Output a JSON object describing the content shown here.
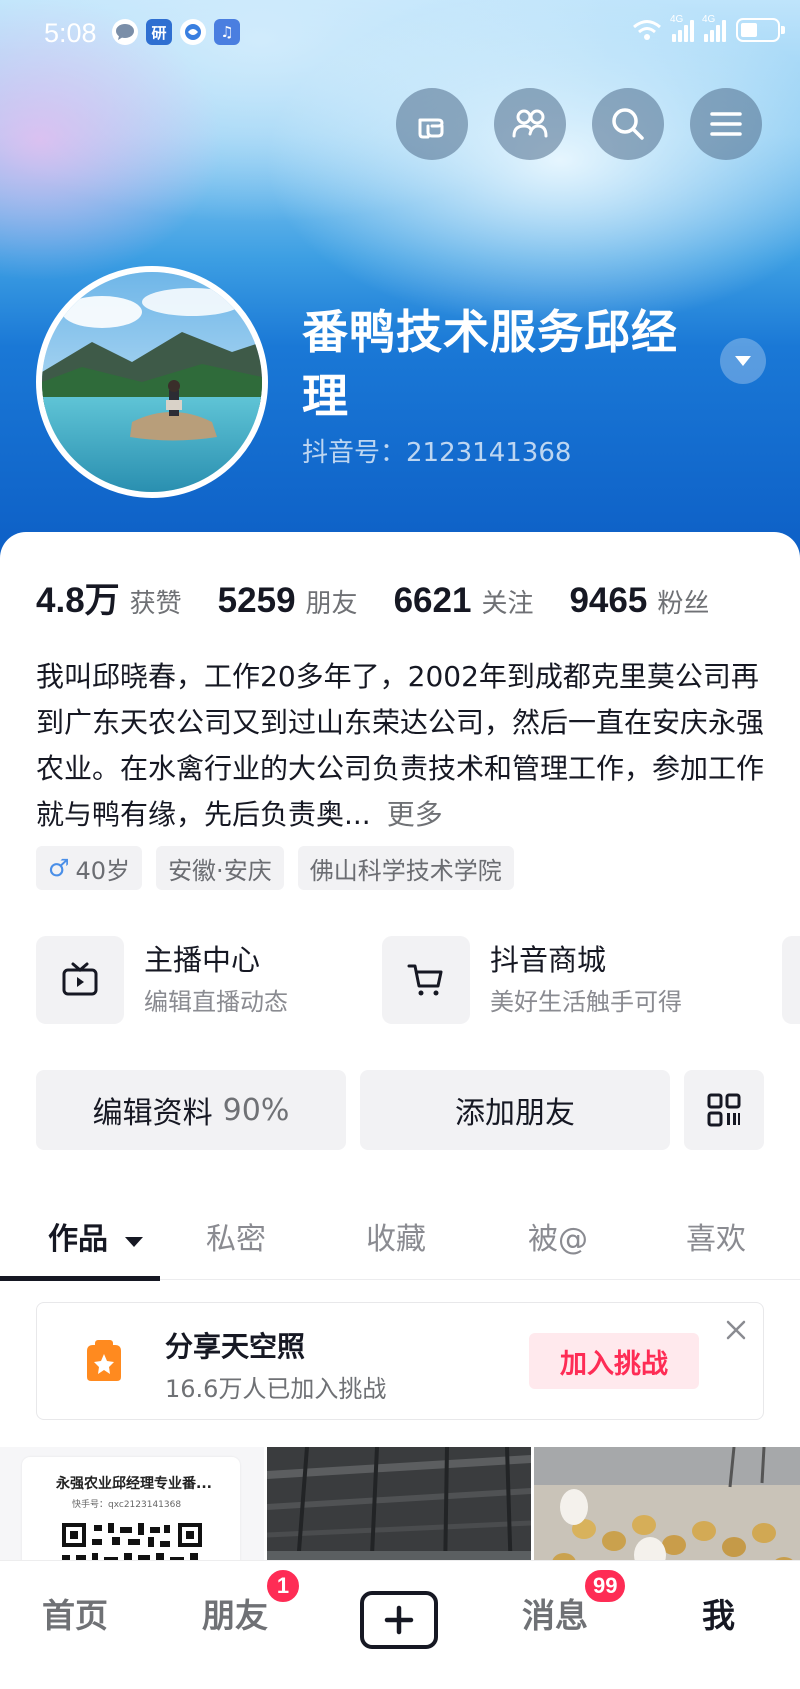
{
  "status_bar": {
    "time": "5:08",
    "app_icons": [
      "message-bubble-icon",
      "dictionary-app-icon",
      "browser-app-icon",
      "music-app-icon"
    ],
    "network_labels": [
      "4G",
      "4G"
    ],
    "battery_level": 0.35
  },
  "header_actions": [
    "hand-pointer-icon",
    "friends-icon",
    "search-icon",
    "menu-icon"
  ],
  "profile": {
    "nickname": "番鸭技术服务邱经理",
    "douyin_id": "抖音号：2123141368"
  },
  "stats": [
    {
      "num": "4.8万",
      "label": "获赞"
    },
    {
      "num": "5259",
      "label": "朋友"
    },
    {
      "num": "6621",
      "label": "关注"
    },
    {
      "num": "9465",
      "label": "粉丝"
    }
  ],
  "bio": {
    "text": "我叫邱晓春，工作20多年了，2002年到成都克里莫公司再到广东天农公司又到过山东荣达公司，然后一直在安庆永强农业。在水禽行业的大公司负责技术和管理工作，参加工作就与鸭有缘，先后负责奥...",
    "more": "更多"
  },
  "tags": {
    "age": "40岁",
    "location": "安徽·安庆",
    "school": "佛山科学技术学院"
  },
  "services": [
    {
      "title": "主播中心",
      "subtitle": "编辑直播动态",
      "icon": "tv-icon"
    },
    {
      "title": "抖音商城",
      "subtitle": "美好生活触手可得",
      "icon": "cart-icon"
    }
  ],
  "actions": {
    "edit_label": "编辑资料",
    "edit_percent": "90%",
    "add_friend": "添加朋友"
  },
  "tabs": [
    {
      "label": "作品",
      "active": true
    },
    {
      "label": "私密",
      "active": false
    },
    {
      "label": "收藏",
      "active": false
    },
    {
      "label": "被@",
      "active": false
    },
    {
      "label": "喜欢",
      "active": false
    }
  ],
  "challenge": {
    "title": "分享天空照",
    "subtitle": "16.6万人已加入挑战",
    "button": "加入挑战"
  },
  "videos": [
    {
      "title": "永强农业邱经理专业番...",
      "subtitle": "快手号：qxc2123141368"
    },
    {},
    {}
  ],
  "bottom_nav": {
    "items": [
      {
        "label": "首页",
        "active": false
      },
      {
        "label": "朋友",
        "active": false,
        "badge": "1"
      },
      {
        "label": "消息",
        "active": false,
        "badge": "99"
      },
      {
        "label": "我",
        "active": true
      }
    ]
  },
  "colors": {
    "accent": "#fe2c55",
    "cover_blue": "#1a78d6",
    "text_primary": "#161823",
    "text_secondary": "#6f7175"
  }
}
